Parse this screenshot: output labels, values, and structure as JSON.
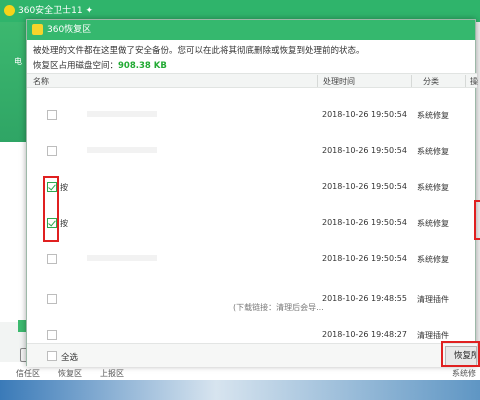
{
  "background": {
    "title": "360安全卫士11 ✦",
    "side_text": "电",
    "bottom_items": [
      "信任区",
      "恢复区",
      "上报区"
    ],
    "bottom_right": "系统修"
  },
  "dialog": {
    "title": "360恢复区",
    "description": "被处理的文件都在这里做了安全备份。您可以在此将其彻底删除或恢复到处理前的状态。",
    "space_label": "恢复区占用磁盘空间：",
    "space_value": "908.38 KB",
    "columns": {
      "name": "名称",
      "time": "处理时间",
      "category": "分类",
      "extra": "操"
    },
    "rows": [
      {
        "checked": false,
        "name": "",
        "time": "2018-10-26 19:50:54",
        "category": "系统修复"
      },
      {
        "checked": false,
        "name": "",
        "time": "2018-10-26 19:50:54",
        "category": "系统修复"
      },
      {
        "checked": true,
        "name": "按",
        "time": "2018-10-26 19:50:54",
        "category": "系统修复"
      },
      {
        "checked": true,
        "name": "按",
        "time": "2018-10-26 19:50:54",
        "category": "系统修复"
      },
      {
        "checked": false,
        "name": "",
        "time": "2018-10-26 19:50:54",
        "category": "系统修复"
      },
      {
        "checked": false,
        "name": "",
        "time": "2018-10-26 19:48:55",
        "category": "清理插件"
      },
      {
        "checked": false,
        "name": "",
        "time": "2018-10-26 19:48:27",
        "category": "清理插件"
      }
    ],
    "hint": "(下载链接：清理后会导...",
    "select_all_label": "全选",
    "restore_button": "恢复所"
  },
  "colors": {
    "accent": "#35b86e",
    "highlight": "#e02020",
    "space_value": "#22aa33"
  }
}
